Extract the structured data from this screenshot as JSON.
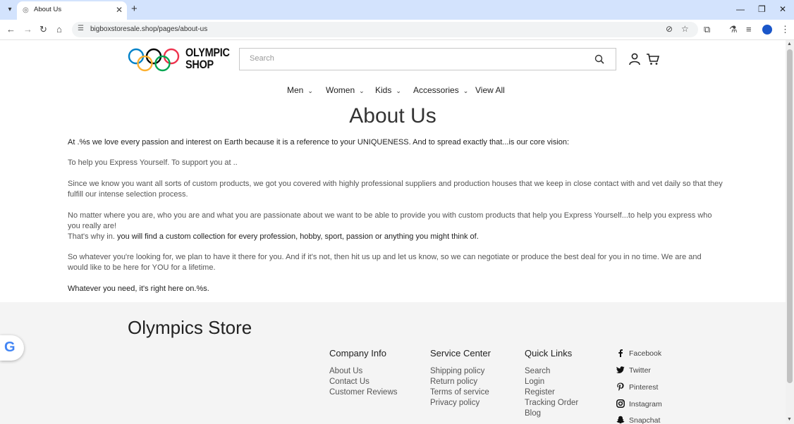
{
  "browser": {
    "tab_title": "About Us",
    "url": "bigboxstoresale.shop/pages/about-us"
  },
  "header": {
    "logo_line1": "OLYMPIC",
    "logo_line2": "SHOP",
    "search_placeholder": "Search"
  },
  "nav": {
    "items": [
      {
        "label": "Men"
      },
      {
        "label": "Women"
      },
      {
        "label": "Kids"
      },
      {
        "label": "Accessories"
      },
      {
        "label": "View All"
      }
    ]
  },
  "page": {
    "title": "About Us",
    "p1": "At .%s we love every passion and interest on Earth because it is a reference to your UNIQUENESS. And to spread exactly that...is our core vision:",
    "p2": "To help you Express Yourself. To support you at ..",
    "p3": "Since we know you want all sorts of custom products, we got you covered with highly professional suppliers and production houses that we keep in close contact with and vet daily so that they fulfill our intense selection process.",
    "p4": "No matter where you are, who you are and what you are passionate about we want to be able to provide you with custom products that help you Express Yourself...to help you express who you really are!",
    "p5a": "That's why in. ",
    "p5b": "you will find a custom collection for every profession, hobby, sport, passion or anything you might think of.",
    "p6": "So whatever you're looking for, we plan to have it there for you. And if it's not, then hit us up and let us know, so we can negotiate or produce the best deal for you in no time. We are and would like to be here for YOU for a lifetime.",
    "p7": "Whatever you need, it's right here on.%s."
  },
  "footer": {
    "brand": "Olympics Store",
    "company": {
      "title": "Company Info",
      "links": [
        "About Us",
        "Contact Us",
        "Customer Reviews"
      ]
    },
    "service": {
      "title": "Service Center",
      "links": [
        "Shipping policy",
        "Return policy",
        "Terms of service",
        "Privacy policy"
      ]
    },
    "quick": {
      "title": "Quick Links",
      "links": [
        "Search",
        "Login",
        "Register",
        "Tracking Order",
        "Blog"
      ]
    },
    "social": [
      "Facebook",
      "Twitter",
      "Pinterest",
      "Instagram",
      "Snapchat"
    ]
  },
  "colors": {
    "tabbar": "#d3e3fd",
    "footer_bg": "#f4f4f4",
    "text_dark": "#222222",
    "text_muted": "#555555"
  },
  "icons": [
    "search-icon",
    "account-icon",
    "cart-icon",
    "facebook-icon",
    "twitter-icon",
    "pinterest-icon",
    "instagram-icon",
    "snapchat-icon",
    "google-icon"
  ]
}
